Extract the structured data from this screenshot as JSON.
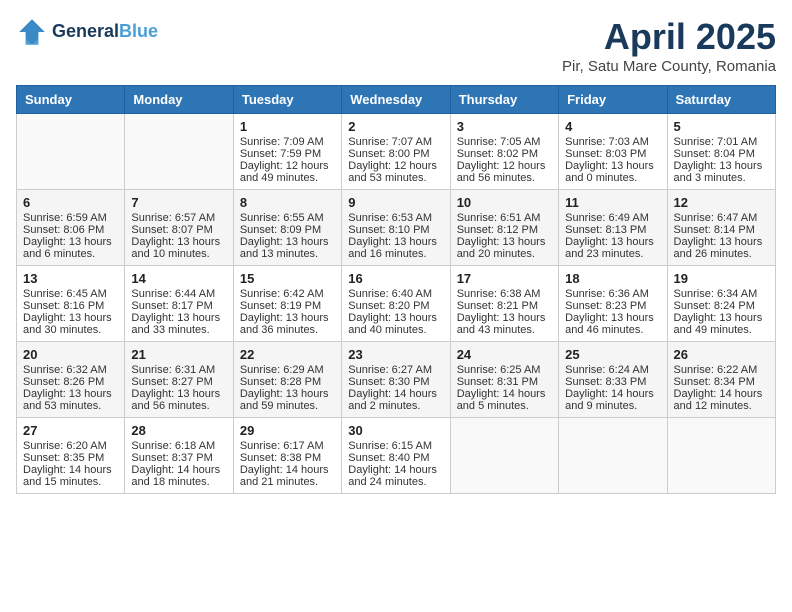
{
  "header": {
    "logo_line1": "General",
    "logo_line2": "Blue",
    "month": "April 2025",
    "location": "Pir, Satu Mare County, Romania"
  },
  "days_of_week": [
    "Sunday",
    "Monday",
    "Tuesday",
    "Wednesday",
    "Thursday",
    "Friday",
    "Saturday"
  ],
  "weeks": [
    [
      {
        "day": "",
        "info": ""
      },
      {
        "day": "",
        "info": ""
      },
      {
        "day": "1",
        "info": "Sunrise: 7:09 AM\nSunset: 7:59 PM\nDaylight: 12 hours and 49 minutes."
      },
      {
        "day": "2",
        "info": "Sunrise: 7:07 AM\nSunset: 8:00 PM\nDaylight: 12 hours and 53 minutes."
      },
      {
        "day": "3",
        "info": "Sunrise: 7:05 AM\nSunset: 8:02 PM\nDaylight: 12 hours and 56 minutes."
      },
      {
        "day": "4",
        "info": "Sunrise: 7:03 AM\nSunset: 8:03 PM\nDaylight: 13 hours and 0 minutes."
      },
      {
        "day": "5",
        "info": "Sunrise: 7:01 AM\nSunset: 8:04 PM\nDaylight: 13 hours and 3 minutes."
      }
    ],
    [
      {
        "day": "6",
        "info": "Sunrise: 6:59 AM\nSunset: 8:06 PM\nDaylight: 13 hours and 6 minutes."
      },
      {
        "day": "7",
        "info": "Sunrise: 6:57 AM\nSunset: 8:07 PM\nDaylight: 13 hours and 10 minutes."
      },
      {
        "day": "8",
        "info": "Sunrise: 6:55 AM\nSunset: 8:09 PM\nDaylight: 13 hours and 13 minutes."
      },
      {
        "day": "9",
        "info": "Sunrise: 6:53 AM\nSunset: 8:10 PM\nDaylight: 13 hours and 16 minutes."
      },
      {
        "day": "10",
        "info": "Sunrise: 6:51 AM\nSunset: 8:12 PM\nDaylight: 13 hours and 20 minutes."
      },
      {
        "day": "11",
        "info": "Sunrise: 6:49 AM\nSunset: 8:13 PM\nDaylight: 13 hours and 23 minutes."
      },
      {
        "day": "12",
        "info": "Sunrise: 6:47 AM\nSunset: 8:14 PM\nDaylight: 13 hours and 26 minutes."
      }
    ],
    [
      {
        "day": "13",
        "info": "Sunrise: 6:45 AM\nSunset: 8:16 PM\nDaylight: 13 hours and 30 minutes."
      },
      {
        "day": "14",
        "info": "Sunrise: 6:44 AM\nSunset: 8:17 PM\nDaylight: 13 hours and 33 minutes."
      },
      {
        "day": "15",
        "info": "Sunrise: 6:42 AM\nSunset: 8:19 PM\nDaylight: 13 hours and 36 minutes."
      },
      {
        "day": "16",
        "info": "Sunrise: 6:40 AM\nSunset: 8:20 PM\nDaylight: 13 hours and 40 minutes."
      },
      {
        "day": "17",
        "info": "Sunrise: 6:38 AM\nSunset: 8:21 PM\nDaylight: 13 hours and 43 minutes."
      },
      {
        "day": "18",
        "info": "Sunrise: 6:36 AM\nSunset: 8:23 PM\nDaylight: 13 hours and 46 minutes."
      },
      {
        "day": "19",
        "info": "Sunrise: 6:34 AM\nSunset: 8:24 PM\nDaylight: 13 hours and 49 minutes."
      }
    ],
    [
      {
        "day": "20",
        "info": "Sunrise: 6:32 AM\nSunset: 8:26 PM\nDaylight: 13 hours and 53 minutes."
      },
      {
        "day": "21",
        "info": "Sunrise: 6:31 AM\nSunset: 8:27 PM\nDaylight: 13 hours and 56 minutes."
      },
      {
        "day": "22",
        "info": "Sunrise: 6:29 AM\nSunset: 8:28 PM\nDaylight: 13 hours and 59 minutes."
      },
      {
        "day": "23",
        "info": "Sunrise: 6:27 AM\nSunset: 8:30 PM\nDaylight: 14 hours and 2 minutes."
      },
      {
        "day": "24",
        "info": "Sunrise: 6:25 AM\nSunset: 8:31 PM\nDaylight: 14 hours and 5 minutes."
      },
      {
        "day": "25",
        "info": "Sunrise: 6:24 AM\nSunset: 8:33 PM\nDaylight: 14 hours and 9 minutes."
      },
      {
        "day": "26",
        "info": "Sunrise: 6:22 AM\nSunset: 8:34 PM\nDaylight: 14 hours and 12 minutes."
      }
    ],
    [
      {
        "day": "27",
        "info": "Sunrise: 6:20 AM\nSunset: 8:35 PM\nDaylight: 14 hours and 15 minutes."
      },
      {
        "day": "28",
        "info": "Sunrise: 6:18 AM\nSunset: 8:37 PM\nDaylight: 14 hours and 18 minutes."
      },
      {
        "day": "29",
        "info": "Sunrise: 6:17 AM\nSunset: 8:38 PM\nDaylight: 14 hours and 21 minutes."
      },
      {
        "day": "30",
        "info": "Sunrise: 6:15 AM\nSunset: 8:40 PM\nDaylight: 14 hours and 24 minutes."
      },
      {
        "day": "",
        "info": ""
      },
      {
        "day": "",
        "info": ""
      },
      {
        "day": "",
        "info": ""
      }
    ]
  ]
}
